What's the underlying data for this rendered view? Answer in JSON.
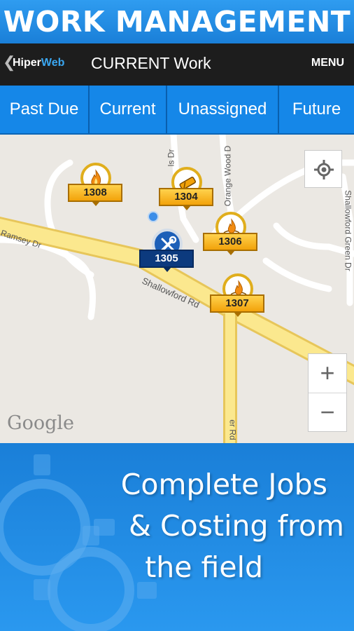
{
  "banner": {
    "title": "WORK MANAGEMENT"
  },
  "appbar": {
    "logo_part1": "Hiper",
    "logo_part2": "Web",
    "title": "CURRENT Work",
    "menu_label": "MENU"
  },
  "tabs": [
    {
      "label": "Past Due"
    },
    {
      "label": "Current"
    },
    {
      "label": "Unassigned"
    },
    {
      "label": "Future"
    }
  ],
  "map": {
    "roads": {
      "ramsey": "Ramsey Dr",
      "shallowford": "Shallowford Rd",
      "orange_wood": "Orange Wood D",
      "shallowford_green": "Shallowford Green Dr",
      "vertical_1": "ls Dr",
      "vertical_2": "er Rd"
    },
    "attribution": "Google",
    "zoom_in": "+",
    "zoom_out": "−",
    "markers": [
      {
        "id": "1308",
        "icon": "flame-icon",
        "style": "gold"
      },
      {
        "id": "1304",
        "icon": "pipe-icon",
        "style": "gold"
      },
      {
        "id": "1306",
        "icon": "flame-icon",
        "style": "gold"
      },
      {
        "id": "1305",
        "icon": "tools-icon",
        "style": "blue"
      },
      {
        "id": "1307",
        "icon": "flame-icon",
        "style": "gold"
      }
    ]
  },
  "promo": {
    "line1": "Complete Jobs",
    "line2": "& Costing from",
    "line3": "the field"
  },
  "colors": {
    "banner_blue": "#1a7fd8",
    "tab_blue": "#1587e8",
    "appbar_dark": "#1d1d1d",
    "marker_gold": "#f2a20a",
    "marker_blue": "#0c3a7e"
  }
}
